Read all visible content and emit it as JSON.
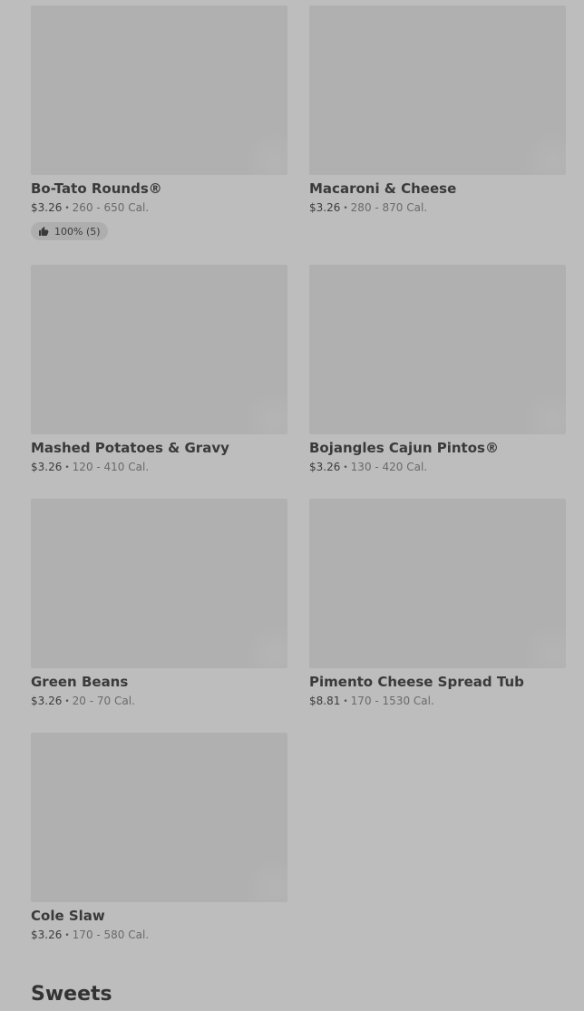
{
  "items": [
    {
      "name": "Bo-Tato Rounds®",
      "price": "$3.26",
      "calories": "260 - 650 Cal.",
      "rating": "100% (5)"
    },
    {
      "name": "Macaroni & Cheese",
      "price": "$3.26",
      "calories": "280 - 870 Cal."
    },
    {
      "name": "Mashed Potatoes & Gravy",
      "price": "$3.26",
      "calories": "120 - 410 Cal."
    },
    {
      "name": "Bojangles Cajun Pintos®",
      "price": "$3.26",
      "calories": "130 - 420 Cal."
    },
    {
      "name": "Green Beans",
      "price": "$3.26",
      "calories": "20 - 70 Cal."
    },
    {
      "name": "Pimento Cheese Spread Tub",
      "price": "$8.81",
      "calories": "170 - 1530 Cal."
    },
    {
      "name": "Cole Slaw",
      "price": "$3.26",
      "calories": "170 - 580 Cal."
    }
  ],
  "separator": "•",
  "next_section": {
    "title": "Sweets"
  },
  "icons": {
    "rating": "thumbs-up-icon"
  }
}
